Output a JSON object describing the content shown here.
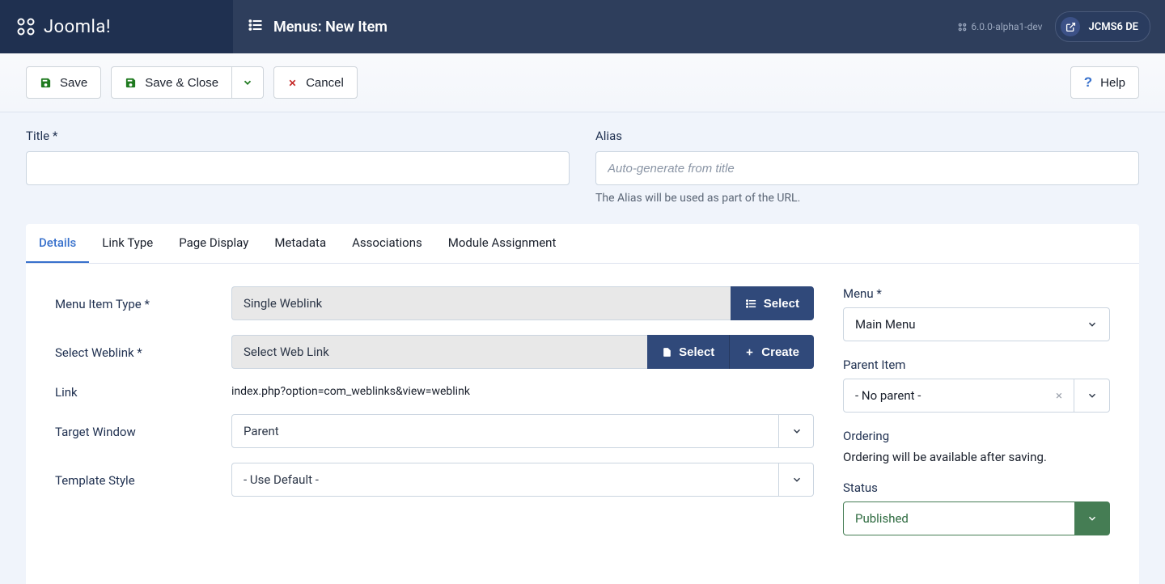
{
  "header": {
    "logo_text": "Joomla!",
    "page_title": "Menus: New Item",
    "version": "6.0.0-alpha1-dev",
    "site_badge": "JCMS6 DE"
  },
  "toolbar": {
    "save": "Save",
    "save_close": "Save & Close",
    "cancel": "Cancel",
    "help": "Help"
  },
  "title_row": {
    "title_label": "Title *",
    "alias_label": "Alias",
    "alias_placeholder": "Auto-generate from title",
    "alias_help": "The Alias will be used as part of the URL."
  },
  "tabs": [
    {
      "label": "Details",
      "active": true
    },
    {
      "label": "Link Type",
      "active": false
    },
    {
      "label": "Page Display",
      "active": false
    },
    {
      "label": "Metadata",
      "active": false
    },
    {
      "label": "Associations",
      "active": false
    },
    {
      "label": "Module Assignment",
      "active": false
    }
  ],
  "details": {
    "menu_item_type_label": "Menu Item Type *",
    "menu_item_type_value": "Single Weblink",
    "select_btn": "Select",
    "select_weblink_label": "Select Weblink *",
    "select_weblink_value": "Select Web Link",
    "create_btn": "Create",
    "link_label": "Link",
    "link_value": "index.php?option=com_weblinks&view=weblink",
    "target_window_label": "Target Window",
    "target_window_value": "Parent",
    "template_style_label": "Template Style",
    "template_style_value": "- Use Default -"
  },
  "sidebar": {
    "menu_label": "Menu *",
    "menu_value": "Main Menu",
    "parent_label": "Parent Item",
    "parent_value": "- No parent -",
    "ordering_label": "Ordering",
    "ordering_text": "Ordering will be available after saving.",
    "status_label": "Status",
    "status_value": "Published"
  }
}
